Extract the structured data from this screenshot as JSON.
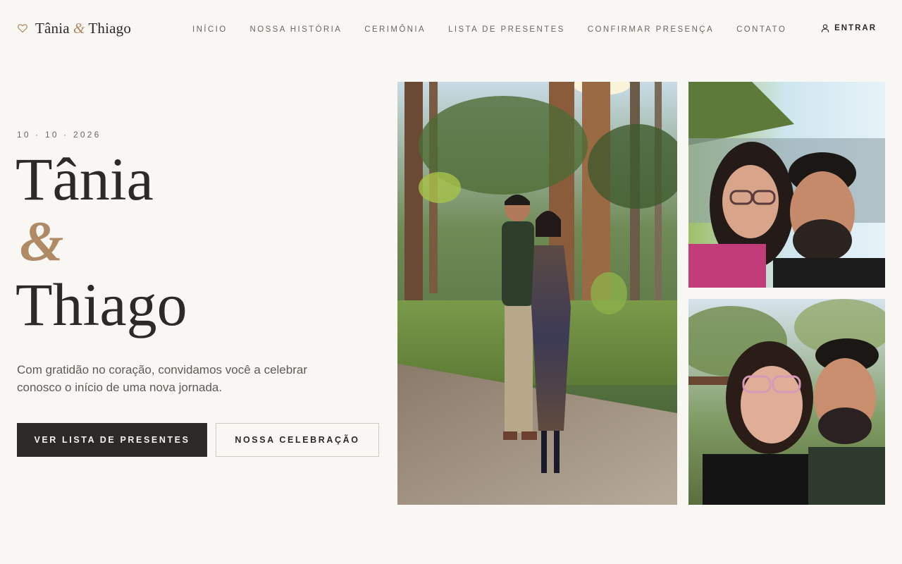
{
  "brand": {
    "first": "Tânia",
    "amp": "&",
    "second": "Thiago",
    "icon": "heart-icon",
    "accent_color": "#b08a64"
  },
  "nav": {
    "items": [
      {
        "label": "INÍCIO"
      },
      {
        "label": "NOSSA HISTÓRIA"
      },
      {
        "label": "CERIMÔNIA"
      },
      {
        "label": "LISTA DE PRESENTES"
      },
      {
        "label": "CONFIRMAR PRESENÇA"
      },
      {
        "label": "CONTATO"
      }
    ],
    "login_label": "ENTRAR",
    "login_icon": "user-icon"
  },
  "hero": {
    "date": "10 · 10 · 2026",
    "name_first": "Tânia",
    "name_amp": "&",
    "name_second": "Thiago",
    "lead": "Com gratidão no coração, convidamos você a celebrar conosco o início de uma nova jornada.",
    "primary_button": "VER LISTA DE PRESENTES",
    "secondary_button": "NOSSA CELEBRAÇÃO"
  },
  "photos": {
    "main": "couple-standing-in-forest-photo",
    "top_right": "couple-selfie-lake-photo",
    "bottom_right": "couple-selfie-trees-photo"
  },
  "colors": {
    "background": "#f8f7f3",
    "text": "#2b2a28",
    "accent": "#b08a64",
    "primary_button_bg": "#2b2a28"
  }
}
